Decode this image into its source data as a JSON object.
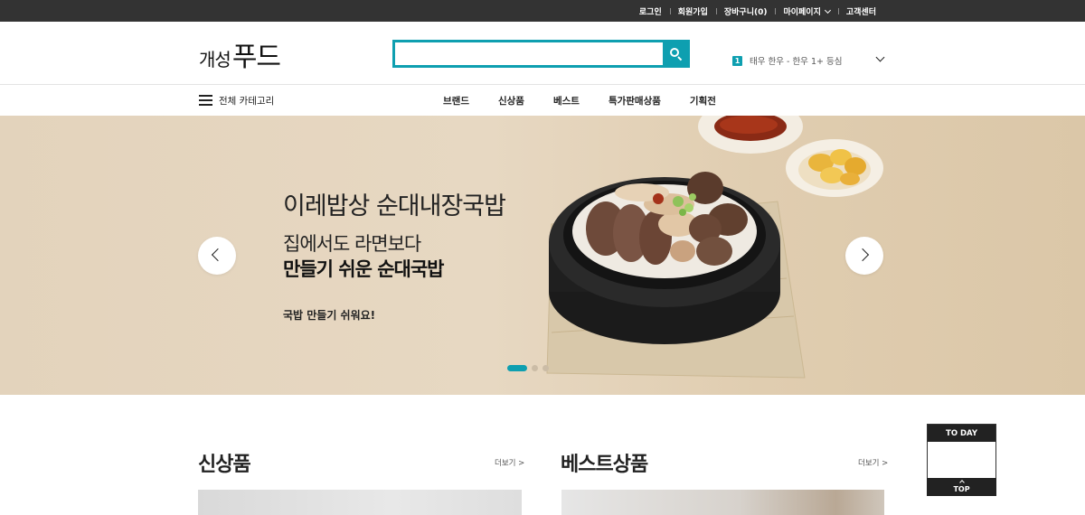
{
  "topbar": {
    "links": [
      "로그인",
      "회원가입",
      "장바구니(0)",
      "마이페이지",
      "고객센터"
    ]
  },
  "header": {
    "logo_small": "개성",
    "logo_big": "푸드",
    "search_placeholder": "",
    "rank_number": "1",
    "rank_keyword": "태우 한우 - 한우 1+ 등심"
  },
  "gnb": {
    "all_categories": "전체 카테고리",
    "menu": [
      "브랜드",
      "신상품",
      "베스트",
      "특가판매상품",
      "기획전"
    ]
  },
  "hero": {
    "title": "이레밥상 순대내장국밥",
    "line2": "집에서도 라면보다",
    "line3": "만들기 쉬운 순대국밥",
    "line4": "국밥 만들기 쉬워요!",
    "slide_count": 3,
    "active_slide": 1
  },
  "sections": {
    "new": {
      "title": "신상품",
      "more": "더보기 >"
    },
    "best": {
      "title": "베스트상품",
      "more": "더보기 >"
    }
  },
  "today": {
    "header": "TO DAY",
    "top": "TOP"
  },
  "colors": {
    "accent": "#0e9fb0",
    "topbar": "#333333",
    "hero_bg": "#e3d3bc"
  }
}
